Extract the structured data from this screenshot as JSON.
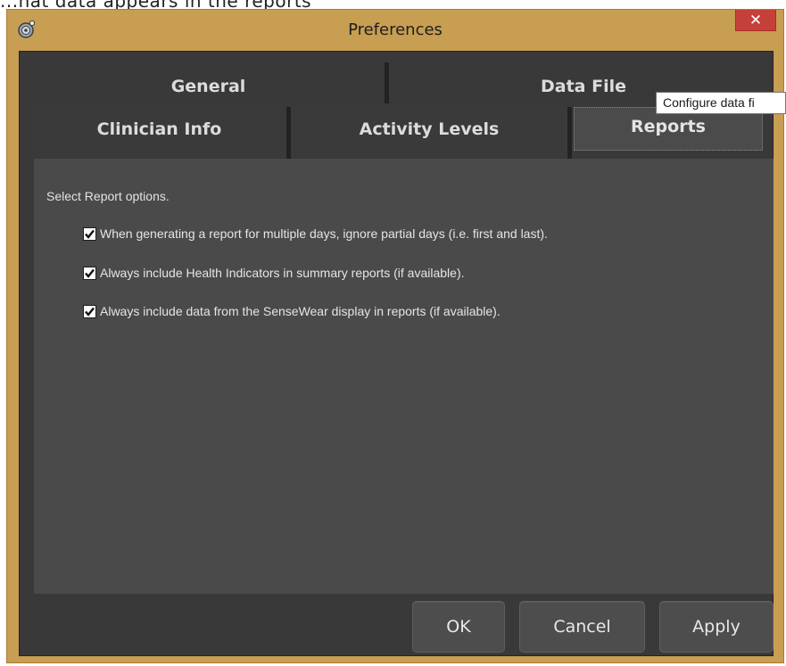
{
  "background": {
    "cut_text": "...hat data appears in the reports"
  },
  "window": {
    "title": "Preferences",
    "close_glyph": "✕",
    "app_icon": "app-icon"
  },
  "tabs": {
    "row1": [
      {
        "label": "General",
        "active": false
      },
      {
        "label": "Data File",
        "active": false
      }
    ],
    "row2": [
      {
        "label": "Clinician Info",
        "active": false
      },
      {
        "label": "Activity Levels",
        "active": false
      },
      {
        "label": "Reports",
        "active": true
      }
    ]
  },
  "tooltip": {
    "text": "Configure data fi"
  },
  "reports_panel": {
    "label": "Select Report options.",
    "options": [
      {
        "label": "When generating a report for multiple days, ignore partial days (i.e. first and last).",
        "checked": true
      },
      {
        "label": "Always include Health Indicators in summary reports (if available).",
        "checked": true
      },
      {
        "label": "Always include data from the SenseWear display in reports (if available).",
        "checked": true
      }
    ]
  },
  "buttons": {
    "ok": "OK",
    "cancel": "Cancel",
    "apply": "Apply"
  },
  "colors": {
    "frame": "#c79e52",
    "client_bg": "#393939",
    "panel_bg": "#4a4a4a",
    "close": "#c6403a"
  }
}
